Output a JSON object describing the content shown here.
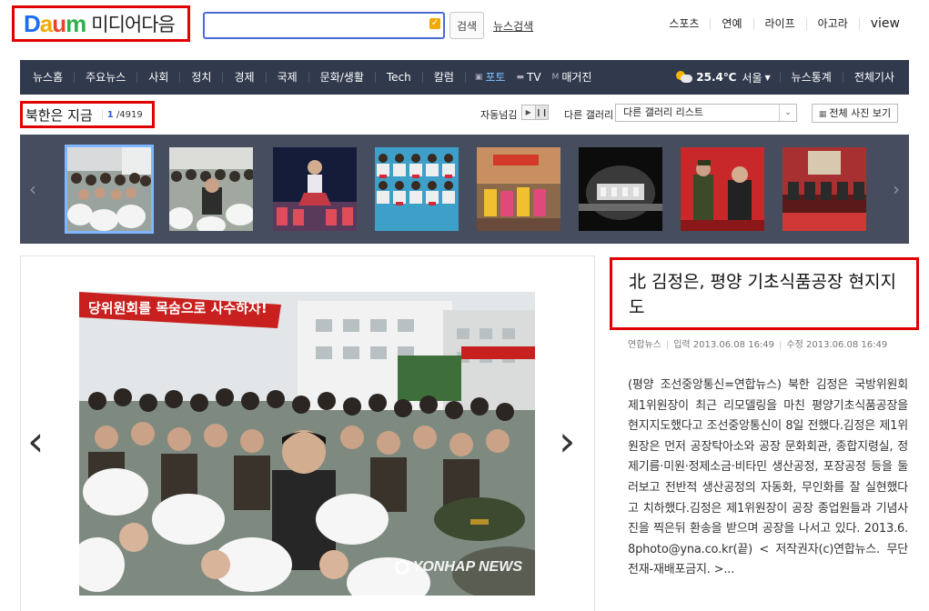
{
  "header": {
    "logo_text": "Daum",
    "logo_colors": [
      "#1b6cf0",
      "#f2a900",
      "#e8442c",
      "#30b04c"
    ],
    "site_name": "미디어다음",
    "search_placeholder": "",
    "search_button": "검색",
    "news_search": "뉴스검색",
    "top_links": [
      "스포츠",
      "연예",
      "라이프",
      "아고라",
      "view"
    ]
  },
  "gnb": {
    "menus": [
      "뉴스홈",
      "주요뉴스",
      "사회",
      "정치",
      "경제",
      "국제",
      "문화/생활",
      "Tech",
      "칼럼"
    ],
    "photo": "포토",
    "tv": "TV",
    "magazine": "매거진",
    "temperature": "25.4℃",
    "city": "서울",
    "stats": "뉴스통계",
    "all_articles": "전체기사"
  },
  "gallery": {
    "title": "북한은 지금",
    "current": "1",
    "total": "/4919",
    "autoplay_label": "자동넘김",
    "other_label": "다른 갤러리",
    "select_value": "다른 갤러리 리스트",
    "all_photos": "전체 사진 보기"
  },
  "article": {
    "title": "北 김정은, 평양 기초식품공장 현지지도",
    "source": "연합뉴스",
    "posted": "입력 2013.06.08 16:49",
    "modified": "수정 2013.06.08 16:49",
    "body": "(평양 조선중앙통신=연합뉴스) 북한 김정은 국방위원회 제1위원장이 최근 리모델링을 마친 평양기초식품공장을 현지지도했다고 조선중앙통신이 8일 전했다.김정은 제1위원장은 먼저 공장탁아소와 공장 문화회관, 종합지령실, 정제기름·미원·정제소금·비타민 생산공정, 포장공정 등을 둘러보고 전반적 생산공정의 자동화, 무인화를 잘 실현했다고 치하했다.김정은 제1위원장이 공장 종업원들과 기념사진을 찍은뒤 환송을 받으며 공장을 나서고 있다. 2013.6.8photo@yna.co.kr(끝) < 저작권자(c)연합뉴스. 무단전재-재배포금지. >...",
    "banner": "당위원회를 목숨으로 사수하자!",
    "watermark": "YONHAP NEWS"
  }
}
